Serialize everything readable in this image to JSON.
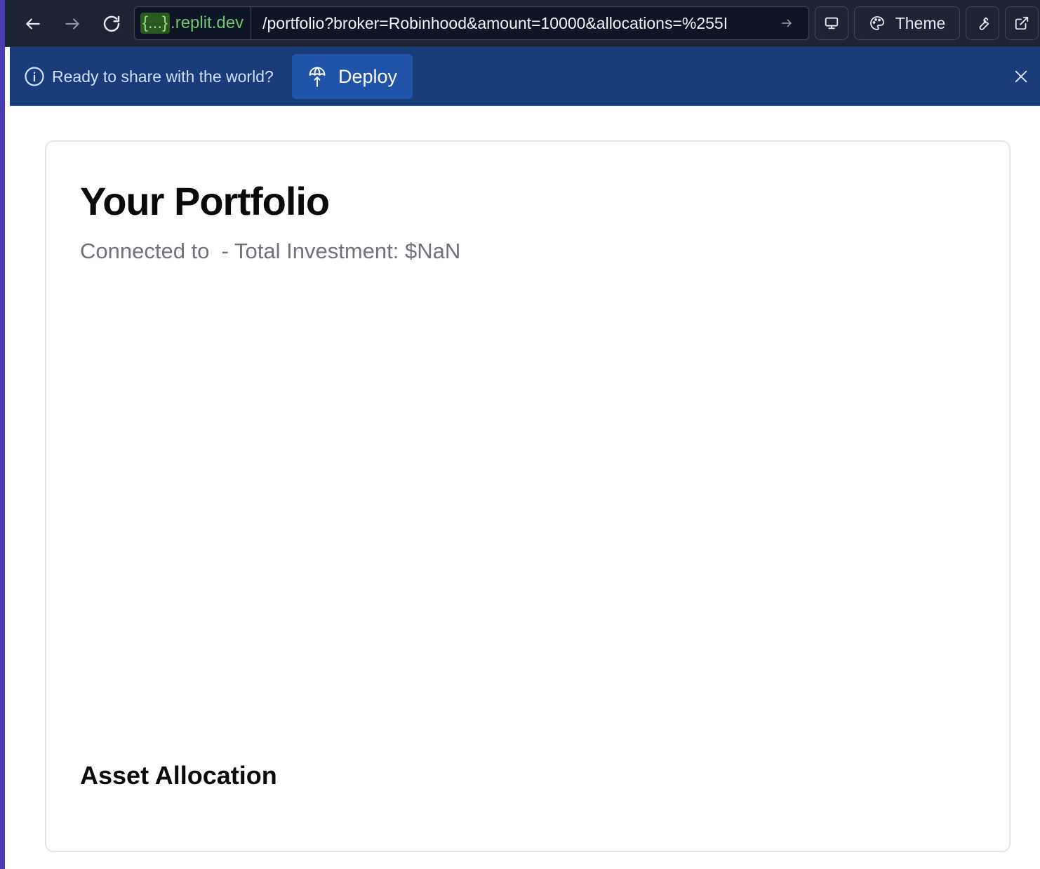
{
  "browser": {
    "domain_badge": "{...}",
    "domain_suffix": ".replit.dev",
    "path": "/portfolio?broker=Robinhood&amount=10000&allocations=%255I",
    "theme_label": "Theme"
  },
  "banner": {
    "message": "Ready to share with the world?",
    "deploy_label": "Deploy"
  },
  "portfolio": {
    "title": "Your Portfolio",
    "subtitle": "Connected to  - Total Investment: $NaN",
    "allocation_heading": "Asset Allocation"
  },
  "colors": {
    "toolbar_bg": "#1c2333",
    "banner_bg": "#183d7a",
    "deploy_button": "#1f54a8",
    "domain_green": "#6cc46c"
  }
}
